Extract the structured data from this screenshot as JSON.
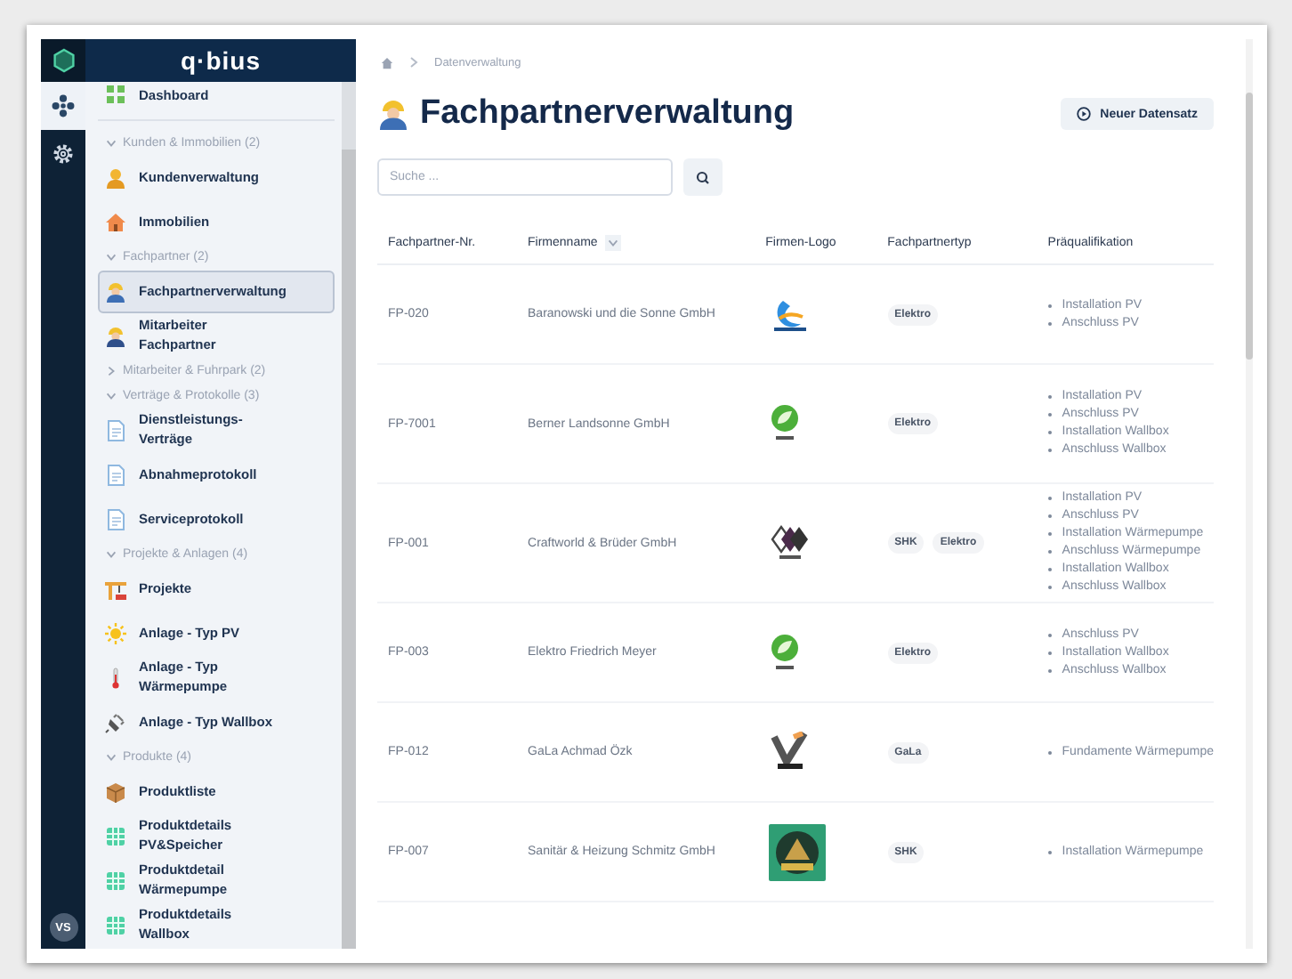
{
  "brand": {
    "logo": "q·bius"
  },
  "rail": {
    "items": [
      {
        "kind": "nodes",
        "selected": true
      },
      {
        "kind": "gear",
        "selected": false
      }
    ],
    "avatar": "VS"
  },
  "sidebar": {
    "top_item": {
      "label": "Dashboard",
      "kind": "grid"
    },
    "groups": [
      {
        "label": "Kunden & Immobilien (2)",
        "expanded": true,
        "items": [
          {
            "label": "Kundenverwaltung",
            "kind": "person",
            "selected": false
          },
          {
            "label": "Immobilien",
            "kind": "house",
            "selected": false
          }
        ]
      },
      {
        "label": "Fachpartner (2)",
        "expanded": true,
        "items": [
          {
            "label": "Fachpartnerverwaltung",
            "kind": "partner",
            "selected": true
          },
          {
            "label": "Mitarbeiter Fachpartner",
            "kind": "worker",
            "selected": false
          }
        ]
      },
      {
        "label": "Mitarbeiter & Fuhrpark (2)",
        "expanded": false
      },
      {
        "label": "Verträge & Protokolle (3)",
        "expanded": true,
        "items": [
          {
            "label": "Dienstleistungs-Verträge",
            "kind": "document",
            "selected": false
          },
          {
            "label": "Abnahmeprotokoll",
            "kind": "document",
            "selected": false
          },
          {
            "label": "Serviceprotokoll",
            "kind": "document",
            "selected": false
          }
        ]
      },
      {
        "label": "Projekte & Anlagen (4)",
        "expanded": true,
        "items": [
          {
            "label": "Projekte",
            "kind": "crane",
            "selected": false
          },
          {
            "label": "Anlage - Typ PV",
            "kind": "sun",
            "selected": false
          },
          {
            "label": "Anlage - Typ Wärmepumpe",
            "kind": "thermometer",
            "selected": false
          },
          {
            "label": "Anlage - Typ Wallbox",
            "kind": "plug",
            "selected": false
          }
        ]
      },
      {
        "label": "Produkte (4)",
        "expanded": true,
        "items": [
          {
            "label": "Produktliste",
            "kind": "box",
            "selected": false
          },
          {
            "label": "Produktdetails PV&Speicher",
            "kind": "table",
            "selected": false
          },
          {
            "label": "Produktdetail Wärmepumpe",
            "kind": "table",
            "selected": false
          },
          {
            "label": "Produktdetails Wallbox",
            "kind": "table",
            "selected": false
          }
        ]
      }
    ]
  },
  "breadcrumb": [
    "Datenverwaltung"
  ],
  "title": "Fachpartnerverwaltung",
  "new_button": "Neuer Datensatz",
  "search": {
    "placeholder": "Suche ..."
  },
  "table": {
    "columns": [
      {
        "label": "Fachpartner-Nr.",
        "sortable": false
      },
      {
        "label": "Firmenname",
        "sortable": true
      },
      {
        "label": "Firmen-Logo",
        "sortable": false
      },
      {
        "label": "Fachpartnertyp",
        "sortable": false
      },
      {
        "label": "Präqualifikation",
        "sortable": false
      }
    ],
    "rows": [
      {
        "nr": "FP-020",
        "name": "Baranowski und die Sonne GmbH",
        "kind": "wave",
        "types": [
          "Elektro"
        ],
        "qualifications": [
          "Installation PV",
          "Anschluss PV"
        ]
      },
      {
        "nr": "FP-7001",
        "name": "Berner Landsonne GmbH",
        "kind": "leaf",
        "types": [
          "Elektro"
        ],
        "qualifications": [
          "Installation PV",
          "Anschluss PV",
          "Installation Wallbox",
          "Anschluss Wallbox"
        ]
      },
      {
        "nr": "FP-001",
        "name": "Craftworld & Brüder GmbH",
        "kind": "diamond",
        "types": [
          "SHK",
          "Elektro"
        ],
        "qualifications": [
          "Installation PV",
          "Anschluss PV",
          "Installation Wärmepumpe",
          "Anschluss Wärmepumpe",
          "Installation Wallbox",
          "Anschluss Wallbox"
        ]
      },
      {
        "nr": "FP-003",
        "name": "Elektro Friedrich Meyer",
        "kind": "leaf",
        "types": [
          "Elektro"
        ],
        "qualifications": [
          "Anschluss PV",
          "Installation Wallbox",
          "Anschluss Wallbox"
        ]
      },
      {
        "nr": "FP-012",
        "name": "GaLa Achmad Özk",
        "kind": "check",
        "types": [
          "GaLa"
        ],
        "qualifications": [
          "Fundamente Wärmepumpe"
        ]
      },
      {
        "nr": "FP-007",
        "name": "Sanitär & Heizung Schmitz GmbH",
        "kind": "emblem",
        "types": [
          "SHK"
        ],
        "qualifications": [
          "Installation Wärmepumpe"
        ]
      }
    ]
  }
}
